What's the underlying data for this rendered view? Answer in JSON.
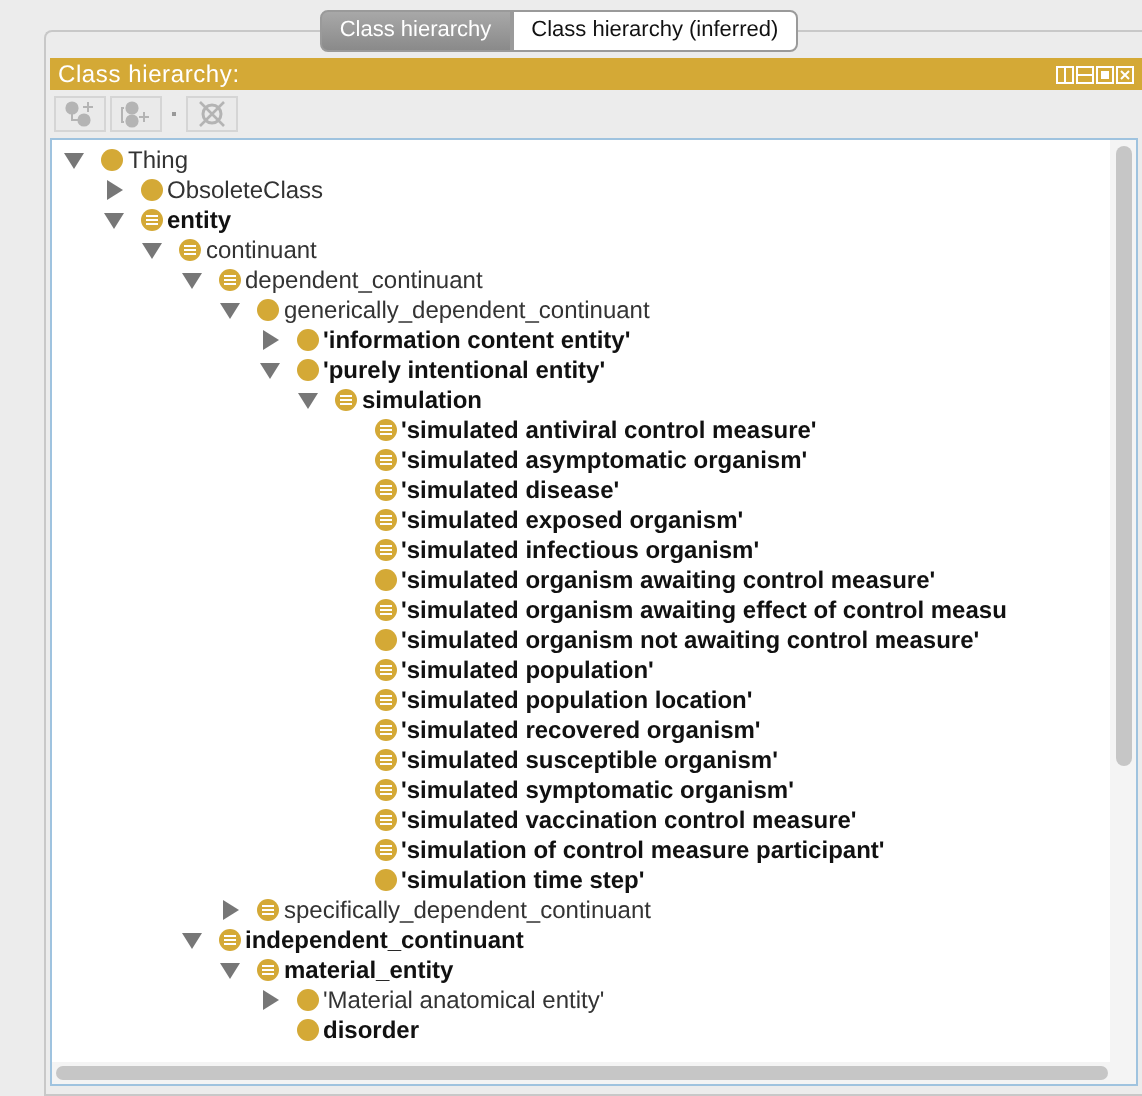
{
  "tabs": [
    {
      "label": "Class hierarchy",
      "selected": true
    },
    {
      "label": "Class hierarchy (inferred)",
      "selected": false
    }
  ],
  "panel": {
    "title": "Class hierarchy:"
  },
  "toolbar": [
    {
      "kind": "add-subclass",
      "disabled": true
    },
    {
      "kind": "add-sibling",
      "disabled": true
    },
    {
      "kind": "delete",
      "disabled": true
    }
  ],
  "tree": [
    {
      "label": "Thing",
      "bold": false,
      "kind": "primitive",
      "expanded": true,
      "children": [
        {
          "label": "ObsoleteClass",
          "bold": false,
          "kind": "primitive",
          "expanded": false
        },
        {
          "label": "entity",
          "bold": true,
          "kind": "defined",
          "expanded": true,
          "children": [
            {
              "label": "continuant",
              "bold": false,
              "kind": "defined",
              "expanded": true,
              "children": [
                {
                  "label": "dependent_continuant",
                  "bold": false,
                  "kind": "defined",
                  "expanded": true,
                  "children": [
                    {
                      "label": "generically_dependent_continuant",
                      "bold": false,
                      "kind": "primitive",
                      "expanded": true,
                      "children": [
                        {
                          "label": "'information content entity'",
                          "bold": true,
                          "kind": "primitive",
                          "expanded": false
                        },
                        {
                          "label": "'purely intentional entity'",
                          "bold": true,
                          "kind": "primitive",
                          "expanded": true,
                          "children": [
                            {
                              "label": "simulation",
                              "bold": true,
                              "kind": "defined",
                              "expanded": true,
                              "children": [
                                {
                                  "label": "'simulated antiviral control measure'",
                                  "bold": true,
                                  "kind": "defined"
                                },
                                {
                                  "label": "'simulated asymptomatic organism'",
                                  "bold": true,
                                  "kind": "defined"
                                },
                                {
                                  "label": "'simulated disease'",
                                  "bold": true,
                                  "kind": "defined"
                                },
                                {
                                  "label": "'simulated exposed organism'",
                                  "bold": true,
                                  "kind": "defined"
                                },
                                {
                                  "label": "'simulated infectious organism'",
                                  "bold": true,
                                  "kind": "defined"
                                },
                                {
                                  "label": "'simulated organism awaiting control measure'",
                                  "bold": true,
                                  "kind": "primitive"
                                },
                                {
                                  "label": "'simulated organism awaiting effect of control measu",
                                  "bold": true,
                                  "kind": "defined"
                                },
                                {
                                  "label": "'simulated organism not awaiting control measure'",
                                  "bold": true,
                                  "kind": "primitive"
                                },
                                {
                                  "label": "'simulated population'",
                                  "bold": true,
                                  "kind": "defined"
                                },
                                {
                                  "label": "'simulated population location'",
                                  "bold": true,
                                  "kind": "defined"
                                },
                                {
                                  "label": "'simulated recovered organism'",
                                  "bold": true,
                                  "kind": "defined"
                                },
                                {
                                  "label": "'simulated susceptible organism'",
                                  "bold": true,
                                  "kind": "defined"
                                },
                                {
                                  "label": "'simulated symptomatic organism'",
                                  "bold": true,
                                  "kind": "defined"
                                },
                                {
                                  "label": "'simulated vaccination control measure'",
                                  "bold": true,
                                  "kind": "defined"
                                },
                                {
                                  "label": "'simulation of control measure participant'",
                                  "bold": true,
                                  "kind": "defined"
                                },
                                {
                                  "label": "'simulation time step'",
                                  "bold": true,
                                  "kind": "primitive"
                                }
                              ]
                            }
                          ]
                        }
                      ]
                    },
                    {
                      "label": "specifically_dependent_continuant",
                      "bold": false,
                      "kind": "defined",
                      "expanded": false
                    }
                  ]
                },
                {
                  "label": "independent_continuant",
                  "bold": true,
                  "kind": "defined",
                  "expanded": true,
                  "children": [
                    {
                      "label": "material_entity",
                      "bold": true,
                      "kind": "defined",
                      "expanded": true,
                      "children": [
                        {
                          "label": "'Material anatomical entity'",
                          "bold": false,
                          "kind": "primitive",
                          "expanded": false
                        },
                        {
                          "label": "disorder",
                          "bold": true,
                          "kind": "primitive"
                        }
                      ]
                    }
                  ]
                }
              ]
            }
          ]
        }
      ]
    }
  ]
}
